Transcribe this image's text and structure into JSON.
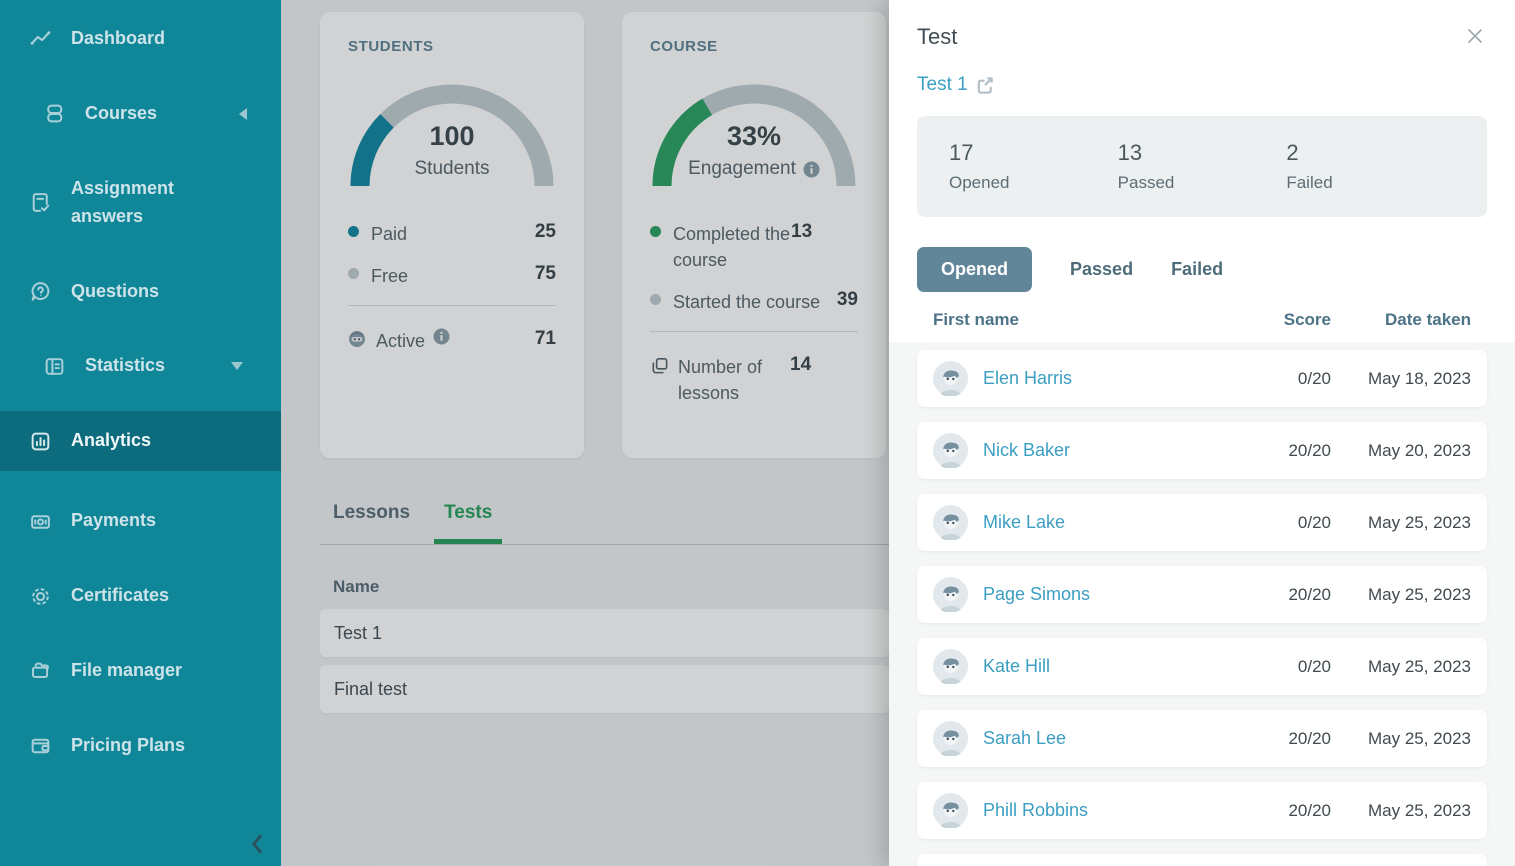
{
  "colors": {
    "sidebar_bg": "#108798",
    "sidebar_active_bg": "#0c6b7c",
    "accent_teal": "#1187a3",
    "accent_green": "#2da263",
    "gauge_track_gray": "#c2cdd1",
    "link_blue": "#3e9fc5",
    "drawer_tab_pill": "#628699",
    "table_header_blue": "#4c7386"
  },
  "icons": {
    "dashboard-icon": "trend-line",
    "courses-icon": "stacked-books",
    "assignment-answers-icon": "document-check",
    "questions-icon": "question-bubble",
    "statistics-icon": "chart-board",
    "analytics-icon": "bar-chart-square",
    "payments-icon": "banknote",
    "certificates-icon": "rosette-badge",
    "file-manager-icon": "folders",
    "pricing-plans-icon": "wallet",
    "sidebar-collapse-icon": "chevron-left",
    "courses-chevron": "triangle-left-collapsed",
    "statistics-chevron": "triangle-down-expanded",
    "info-icon": "filled-circle-i",
    "active-students-icon": "robot-face",
    "lessons-count-icon": "stacked-pages",
    "external-link-icon": "box-with-arrow",
    "close-icon": "x-cross",
    "avatar": "person-placeholder"
  },
  "sidebar": {
    "items": [
      {
        "label": "Dashboard"
      },
      {
        "label": "Courses"
      },
      {
        "label": "Assignment answers"
      },
      {
        "label": "Questions"
      },
      {
        "label": "Statistics"
      },
      {
        "label": "Analytics",
        "active": true
      },
      {
        "label": "Payments"
      },
      {
        "label": "Certificates"
      },
      {
        "label": "File manager"
      },
      {
        "label": "Pricing Plans"
      }
    ]
  },
  "students_card": {
    "title": "STUDENTS",
    "gauge": {
      "value": "100",
      "label": "Students",
      "percent": 25
    },
    "legend": [
      {
        "label": "Paid",
        "value": "25"
      },
      {
        "label": "Free",
        "value": "75"
      }
    ],
    "active": {
      "label": "Active",
      "value": "71"
    }
  },
  "course_card": {
    "title": "COURSE",
    "gauge": {
      "value": "33%",
      "label": "Engagement",
      "percent": 33
    },
    "legend": [
      {
        "label": "Completed the course",
        "value": "13"
      },
      {
        "label": "Started the course",
        "value": "39"
      }
    ],
    "lessons": {
      "label": "Number of lessons",
      "value": "14"
    }
  },
  "content_tabs": {
    "lessons": "Lessons",
    "tests": "Tests",
    "active": "Tests"
  },
  "tests_table": {
    "name_header": "Name",
    "rows": [
      {
        "name": "Test 1"
      },
      {
        "name": "Final test"
      }
    ]
  },
  "drawer": {
    "title": "Test",
    "test_link": "Test 1",
    "stats": [
      {
        "value": "17",
        "label": "Opened"
      },
      {
        "value": "13",
        "label": "Passed"
      },
      {
        "value": "2",
        "label": "Failed"
      }
    ],
    "tabs": [
      "Opened",
      "Passed",
      "Failed"
    ],
    "active_tab": "Opened",
    "table": {
      "headers": {
        "name": "First name",
        "score": "Score",
        "date": "Date taken"
      },
      "rows": [
        {
          "name": "Elen Harris",
          "score": "0/20",
          "date": "May 18, 2023"
        },
        {
          "name": "Nick Baker",
          "score": "20/20",
          "date": "May 20, 2023"
        },
        {
          "name": "Mike Lake",
          "score": "0/20",
          "date": "May 25, 2023"
        },
        {
          "name": "Page Simons",
          "score": "20/20",
          "date": "May 25, 2023"
        },
        {
          "name": "Kate Hill",
          "score": "0/20",
          "date": "May 25, 2023"
        },
        {
          "name": "Sarah Lee",
          "score": "20/20",
          "date": "May 25, 2023"
        },
        {
          "name": "Phill Robbins",
          "score": "20/20",
          "date": "May 25, 2023"
        }
      ]
    }
  }
}
